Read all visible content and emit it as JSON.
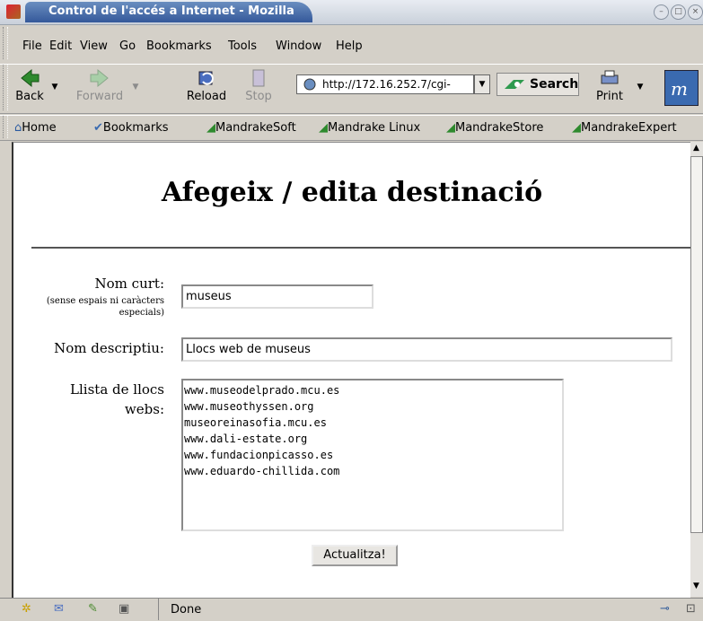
{
  "window": {
    "title": "Control de l'accés a Internet - Mozilla"
  },
  "menu": [
    "File",
    "Edit",
    "View",
    "Go",
    "Bookmarks",
    "Tools",
    "Window",
    "Help"
  ],
  "toolbar": {
    "back": "Back",
    "forward": "Forward",
    "reload": "Reload",
    "stop": "Stop",
    "url": "http://172.16.252.7/cgi-",
    "search": "Search",
    "print": "Print"
  },
  "bookmarks": [
    "Home",
    "Bookmarks",
    "MandrakeSoft",
    "Mandrake Linux",
    "MandrakeStore",
    "MandrakeExpert"
  ],
  "page": {
    "heading": "Afegeix / edita destinació",
    "short_name_label": "Nom curt:",
    "short_name_hint_1": "(sense espais ni caràcters",
    "short_name_hint_2": "especials)",
    "short_name_value": "museus",
    "desc_label": "Nom descriptiu:",
    "desc_value": "Llocs web de museus",
    "sites_label_1": "Llista de llocs",
    "sites_label_2": "webs:",
    "sites": [
      "www.museodelprado.mcu.es",
      "www.museothyssen.org",
      "museoreinasofia.mcu.es",
      "www.dali-estate.org",
      "www.fundacionpicasso.es",
      "www.eduardo-chillida.com"
    ],
    "submit": "Actualitza!"
  },
  "status": {
    "text": "Done"
  },
  "colors": {
    "title_tab": "#4a70ae",
    "accent_green": "#2e8a2e"
  }
}
